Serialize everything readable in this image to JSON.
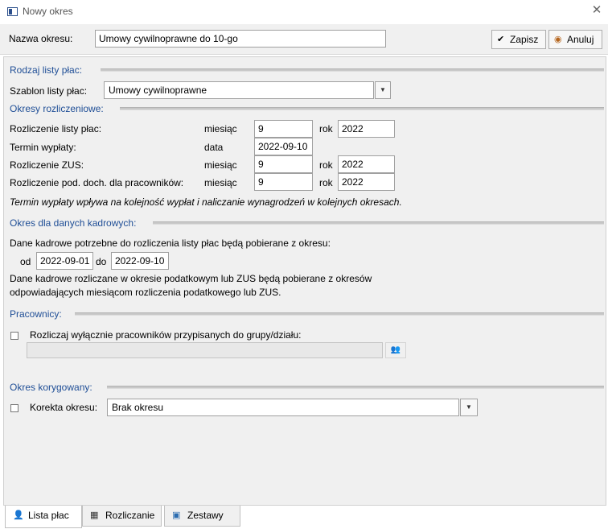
{
  "window": {
    "title": "Nowy okres"
  },
  "header": {
    "name_label": "Nazwa okresu:",
    "name_value": "Umowy cywilnoprawne do 10-go",
    "save_label": "Zapisz",
    "cancel_label": "Anuluj"
  },
  "rodzaj": {
    "section_title": "Rodzaj listy płac:",
    "template_label": "Szablon listy płac:",
    "template_value": "Umowy cywilnoprawne"
  },
  "okresy": {
    "section_title": "Okresy rozliczeniowe:",
    "rows": [
      {
        "label": "Rozliczenie listy płac:",
        "k1": "miesiąc",
        "v1": "9",
        "k2": "rok",
        "v2": "2022"
      },
      {
        "label": "Termin wypłaty:",
        "k1": "data",
        "v1": "2022-09-10"
      },
      {
        "label": "Rozliczenie ZUS:",
        "k1": "miesiąc",
        "v1": "9",
        "k2": "rok",
        "v2": "2022"
      },
      {
        "label": "Rozliczenie pod. doch. dla pracowników:",
        "k1": "miesiąc",
        "v1": "9",
        "k2": "rok",
        "v2": "2022"
      }
    ],
    "note": "Termin wypłaty wpływa na kolejność wypłat i naliczanie wynagrodzeń w kolejnych okresach."
  },
  "kadrowe": {
    "section_title": "Okres dla danych kadrowych:",
    "intro": "Dane kadrowe potrzebne do rozliczenia listy płac będą pobierane z okresu:",
    "from_label": "od",
    "from_value": "2022-09-01",
    "to_label": "do",
    "to_value": "2022-09-10",
    "note_line1": "Dane kadrowe rozliczane w okresie podatkowym lub ZUS będą pobierane z okresów",
    "note_line2": "odpowiadających miesiącom rozliczenia podatkowego lub ZUS."
  },
  "pracownicy": {
    "section_title": "Pracownicy:",
    "checkbox_label": "Rozliczaj wyłącznie pracowników przypisanych do grupy/działu:"
  },
  "korygowany": {
    "section_title": "Okres korygowany:",
    "checkbox_label": "Korekta okresu:",
    "value": "Brak okresu"
  },
  "tabs": [
    {
      "label": "Lista płac",
      "icon": "person-icon",
      "active": true
    },
    {
      "label": "Rozliczanie",
      "icon": "calculator-icon",
      "active": false
    },
    {
      "label": "Zestawy",
      "icon": "set-icon",
      "active": false
    }
  ],
  "colors": {
    "section_title": "#1f4e96",
    "background": "#f0f0f0"
  }
}
